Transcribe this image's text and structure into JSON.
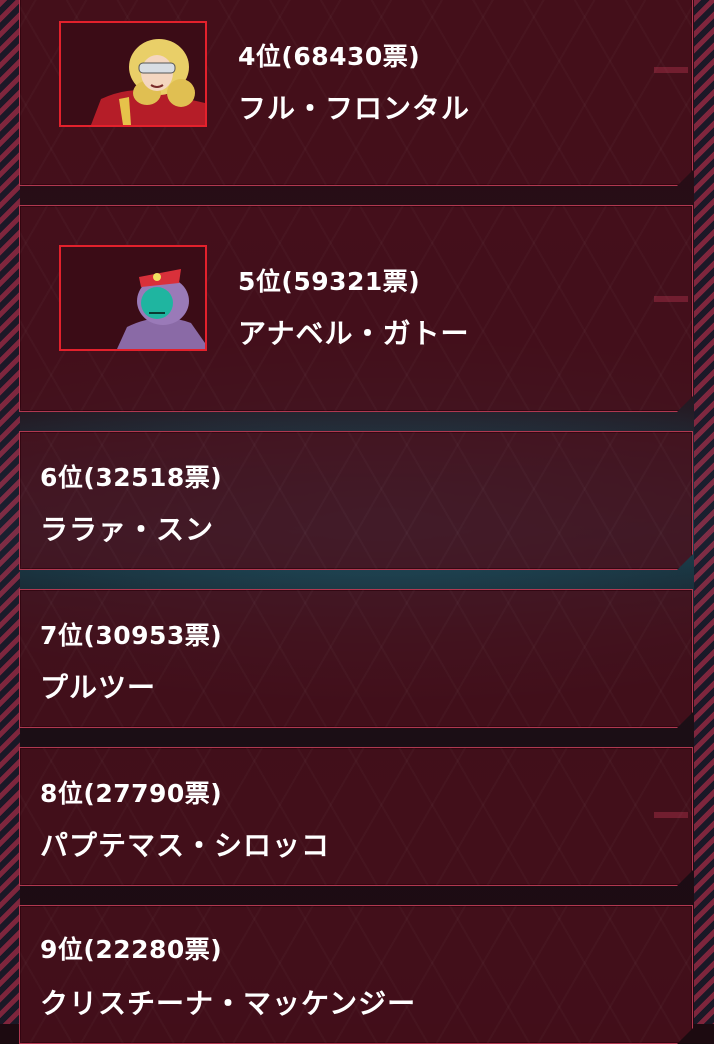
{
  "ranking": [
    {
      "rank_text": "4位(68430票)",
      "name": "フル・フロンタル",
      "has_portrait": true
    },
    {
      "rank_text": "5位(59321票)",
      "name": "アナベル・ガトー",
      "has_portrait": true
    },
    {
      "rank_text": "6位(32518票)",
      "name": "ララァ・スン",
      "has_portrait": false
    },
    {
      "rank_text": "7位(30953票)",
      "name": "プルツー",
      "has_portrait": false
    },
    {
      "rank_text": "8位(27790票)",
      "name": "パプテマス・シロッコ",
      "has_portrait": false
    },
    {
      "rank_text": "9位(22280票)",
      "name": "クリスチーナ・マッケンジー",
      "has_portrait": false
    }
  ],
  "colors": {
    "card_bg": "#4a101c",
    "card_border": "#b03850",
    "portrait_border": "#e3212c",
    "text": "#ffffff"
  }
}
